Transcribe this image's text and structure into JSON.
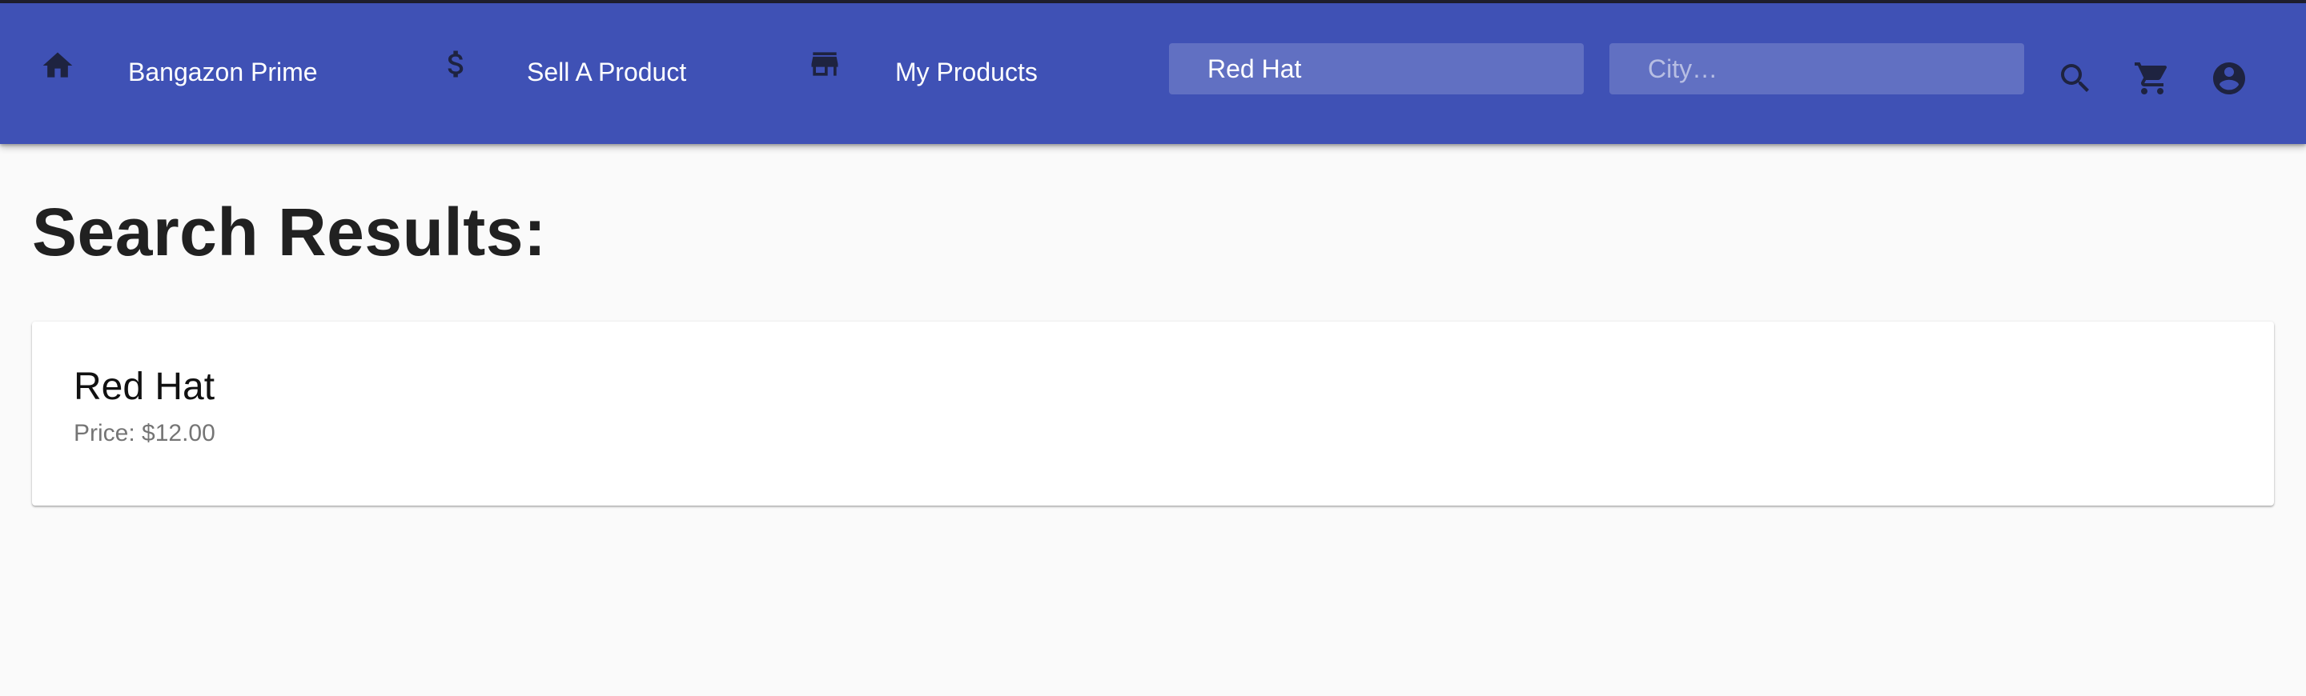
{
  "nav": {
    "home": {
      "label": "Bangazon Prime",
      "icon": "home-icon"
    },
    "sell": {
      "label": "Sell A Product",
      "icon": "dollar-icon"
    },
    "my_products": {
      "label": "My Products",
      "icon": "store-icon"
    }
  },
  "search": {
    "product_value": "Red Hat",
    "product_placeholder": "",
    "city_value": "",
    "city_placeholder": "City…"
  },
  "actions": {
    "search_icon": "search-icon",
    "cart_icon": "cart-icon",
    "account_icon": "account-circle-icon"
  },
  "page": {
    "title": "Search Results:"
  },
  "results": [
    {
      "name": "Red Hat",
      "price": "Price: $12.00"
    }
  ],
  "colors": {
    "appbar": "#3f51b5",
    "icon": "#1e2340",
    "background": "#fafafa",
    "card": "#ffffff"
  }
}
